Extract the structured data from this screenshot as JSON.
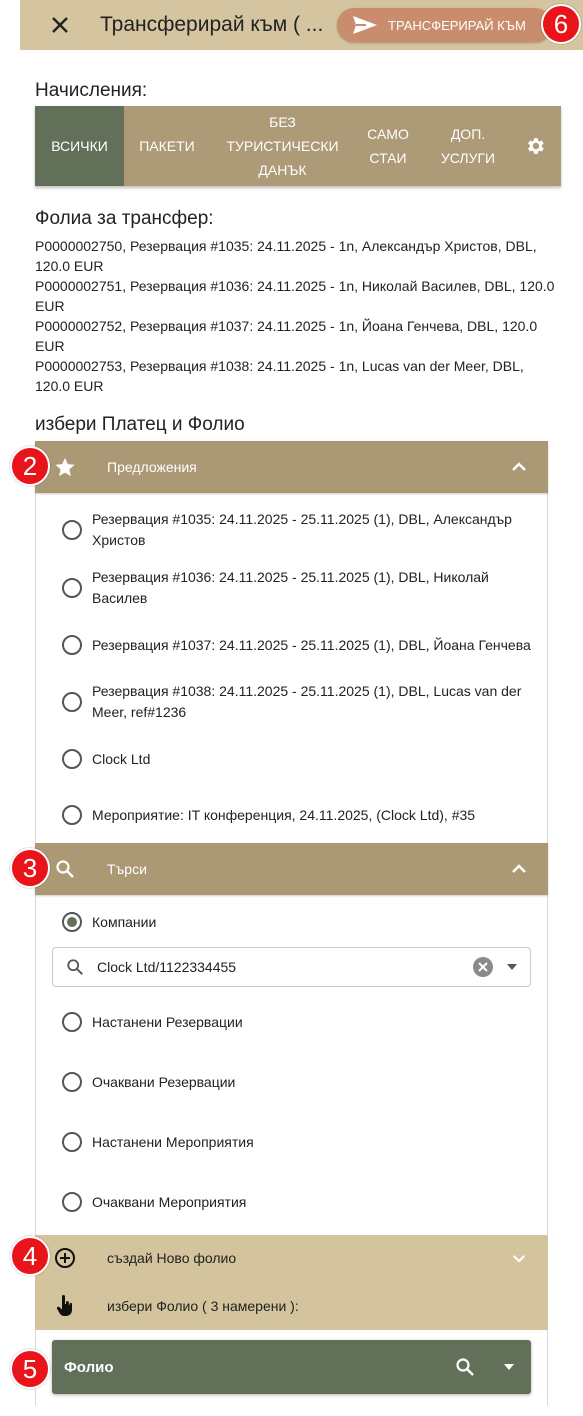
{
  "header": {
    "title": "Трансферирай към ( ...",
    "transfer_button": "ТРАНСФЕРИРАЙ КЪМ"
  },
  "badges": [
    "2",
    "3",
    "4",
    "5",
    "6"
  ],
  "charges": {
    "title": "Начисления:",
    "tabs": [
      {
        "label": "ВСИЧКИ",
        "active": true
      },
      {
        "label": "ПАКЕТИ",
        "active": false
      },
      {
        "label": "БЕЗ\nТУРИСТИЧЕСКИ\nДАНЪК",
        "active": false
      },
      {
        "label": "САМО\nСТАИ",
        "active": false
      },
      {
        "label": "ДОП.\nУСЛУГИ",
        "active": false
      }
    ]
  },
  "folios": {
    "title": "Фолиа за трансфер:",
    "lines": [
      "P0000002750, Резервация #1035: 24.11.2025 - 1n, Александър Христов, DBL, 120.0 EUR",
      "P0000002751, Резервация #1036: 24.11.2025 - 1n, Николай Василев, DBL, 120.0 EUR",
      "P0000002752, Резервация #1037: 24.11.2025 - 1n, Йоана Генчева, DBL, 120.0 EUR",
      "P0000002753, Резервация #1038: 24.11.2025 - 1n, Lucas van der Meer, DBL, 120.0 EUR"
    ]
  },
  "payer": {
    "title": "избери Платец и Фолио",
    "suggestions_header": "Предложения",
    "suggestions": [
      "Резервация #1035: 24.11.2025 - 25.11.2025 (1), DBL, Александър Христов",
      "Резервация #1036: 24.11.2025 - 25.11.2025 (1), DBL, Николай Василев",
      "Резервация #1037: 24.11.2025 - 25.11.2025 (1), DBL, Йоана Генчева",
      "Резервация #1038: 24.11.2025 - 25.11.2025 (1), DBL, Lucas van der Meer, ref#1236",
      "Clock Ltd",
      "Мероприятие: IT конференция, 24.11.2025, (Clock Ltd), #35"
    ],
    "search_header": "Търси",
    "search_options": [
      {
        "label": "Компании",
        "selected": true
      },
      {
        "label": "Настанени Резервации",
        "selected": false
      },
      {
        "label": "Очаквани Резервации",
        "selected": false
      },
      {
        "label": "Настанени Мероприятия",
        "selected": false
      },
      {
        "label": "Очаквани Мероприятия",
        "selected": false
      }
    ],
    "search_value": "Clock Ltd/1122334455",
    "new_folio": "създай Ново фолио",
    "choose_folio": "избери Фолио ( 3 намерени ):",
    "folio_select": "Фолио"
  },
  "colors": {
    "header_bg": "#d4c4a0",
    "tab_bg": "#ad9a76",
    "tab_active": "#62705a",
    "transfer_button": "#c98d6e",
    "badge": "#e8141a"
  },
  "icons": [
    "close-icon",
    "send-icon",
    "gear-icon",
    "star-icon",
    "search-icon",
    "chevron-up-icon",
    "chevron-down-icon",
    "clear-icon",
    "add-circle-icon",
    "pointer-hand-icon"
  ]
}
